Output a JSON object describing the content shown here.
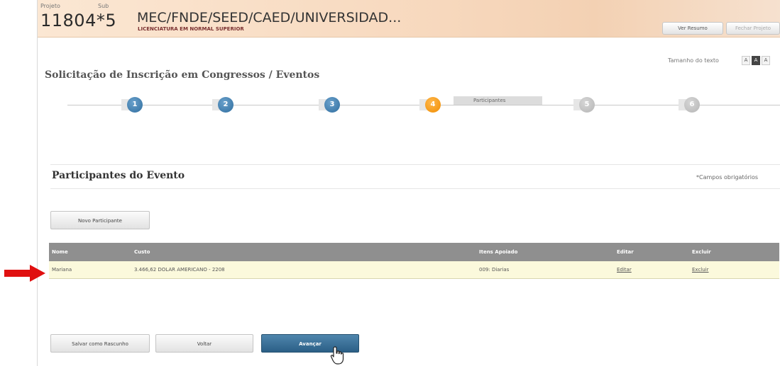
{
  "header": {
    "projeto_label": "Projeto",
    "sub_label": "Sub",
    "project_number": "11804*5",
    "project_title": "MEC/FNDE/SEED/CAED/UNIVERSIDAD...",
    "project_subtitle": "LICENCIATURA EM NORMAL SUPERIOR",
    "ver_resumo": "Ver Resumo",
    "fechar_projeto": "Fechar Projeto"
  },
  "text_size": {
    "label": "Tamanho do texto",
    "small": "A",
    "medium": "A",
    "large": "A"
  },
  "page_title": "Solicitação de Inscrição em Congressos / Eventos",
  "steps": [
    {
      "number": "1",
      "state": "done"
    },
    {
      "number": "2",
      "state": "done"
    },
    {
      "number": "3",
      "state": "done"
    },
    {
      "number": "4",
      "state": "active",
      "label": "Participantes"
    },
    {
      "number": "5",
      "state": "future"
    },
    {
      "number": "6",
      "state": "future"
    }
  ],
  "section": {
    "title": "Participantes do Evento",
    "required_note": "*Campos obrigatórios",
    "new_participant": "Novo Participante"
  },
  "table": {
    "headers": [
      "Nome",
      "Custo",
      "Itens Apoiado",
      "Editar",
      "Excluir"
    ],
    "rows": [
      {
        "nome": "Mariana",
        "custo": "3.466,62 DOLAR AMERICANO - 2208",
        "itens": "009: Diarias",
        "editar": "Editar",
        "excluir": "Excluir"
      }
    ]
  },
  "footer": {
    "save_draft": "Salvar como Rascunho",
    "back": "Voltar",
    "next": "Avançar"
  },
  "colors": {
    "header_bg": "#f7d8bd",
    "step_done": "#2f6d9e",
    "step_active": "#f08c00",
    "primary_btn": "#2b5f86",
    "row_highlight": "#fbf9dc",
    "arrow": "#e01010"
  }
}
